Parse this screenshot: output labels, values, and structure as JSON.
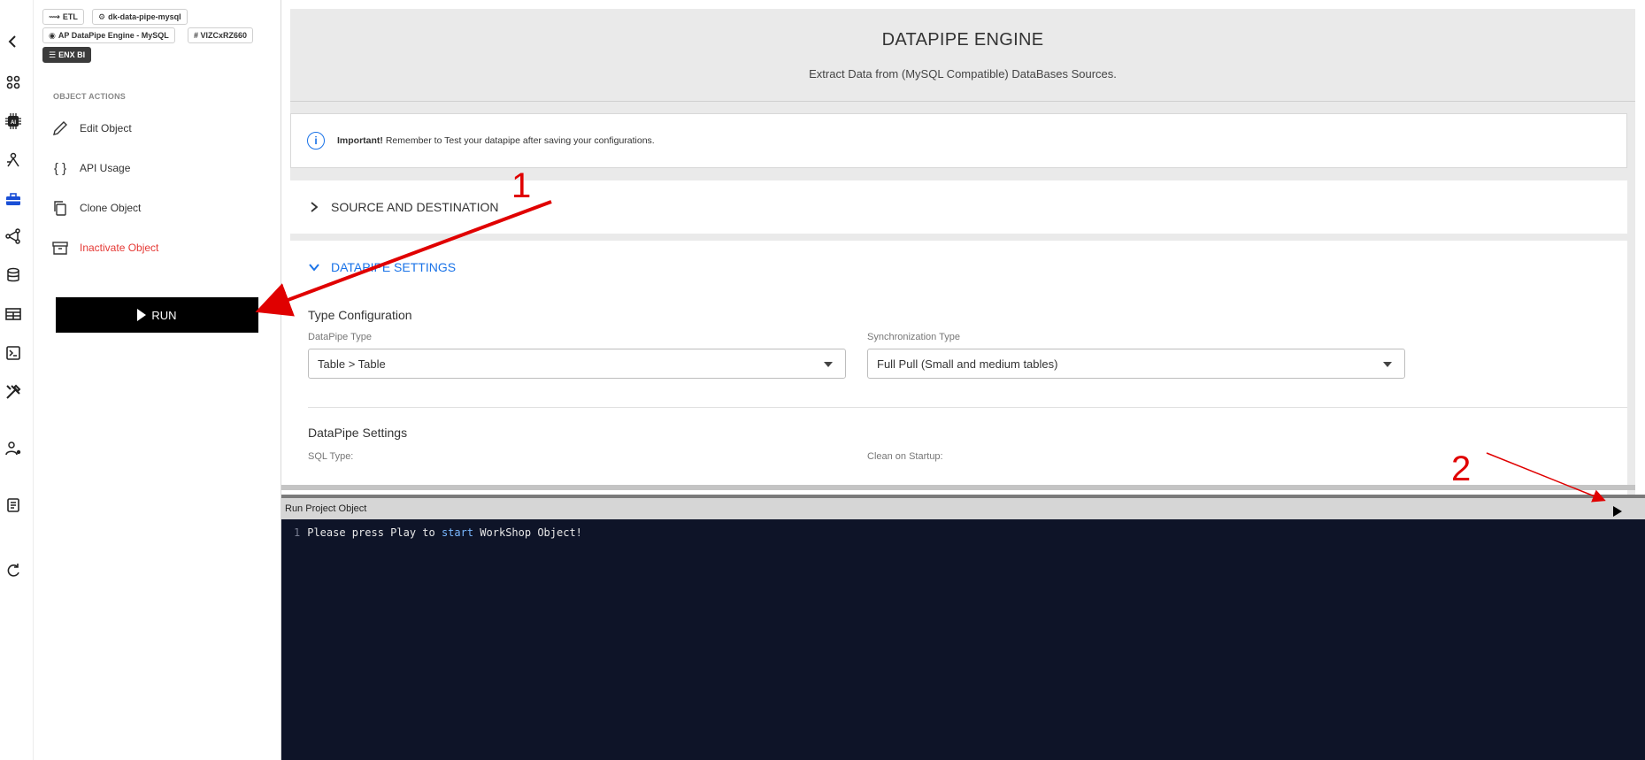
{
  "rail": {
    "icons": [
      "back-icon",
      "apps-icon",
      "ai-chip-icon",
      "integrations-icon",
      "toolbox-icon",
      "pipeline-icon",
      "database-icon",
      "table-icon",
      "terminal-icon",
      "tools-icon",
      "user-settings-icon",
      "document-icon",
      "refresh-icon"
    ],
    "active": "toolbox-icon"
  },
  "panel": {
    "tags": [
      "ETL",
      "dk-data-pipe-mysql",
      "AP DataPipe Engine - MySQL",
      "# VlZCxRZ660",
      "ENX BI"
    ],
    "section_label": "OBJECT ACTIONS",
    "actions": [
      {
        "label": "Edit Object",
        "icon": "pencil-icon"
      },
      {
        "label": "API Usage",
        "icon": "braces-icon"
      },
      {
        "label": "Clone Object",
        "icon": "copy-icon"
      },
      {
        "label": "Inactivate Object",
        "icon": "archive-icon"
      }
    ],
    "run_label": "RUN"
  },
  "main": {
    "title": "DATAPIPE ENGINE",
    "subtitle": "Extract Data from (MySQL Compatible) DataBases Sources.",
    "notice_bold": "Important!",
    "notice_text": " Remember to Test your datapipe after saving your configurations.",
    "accordion_source": "SOURCE AND DESTINATION",
    "accordion_settings": "DATAPIPE SETTINGS",
    "type_config": "Type Configuration",
    "datapipe_type_label": "DataPipe Type",
    "datapipe_type_value": "Table > Table",
    "sync_type_label": "Synchronization Type",
    "sync_type_value": "Full Pull (Small and medium tables)",
    "datapipe_settings": "DataPipe Settings",
    "sql_type_label": "SQL Type:",
    "clean_startup_label": "Clean on Startup:"
  },
  "console": {
    "title": "Run Project Object",
    "line_number": "1",
    "text_before": "Please press Play to ",
    "keyword": "start",
    "text_after": " WorkShop Object!"
  },
  "annotations": {
    "one": "1",
    "two": "2",
    "color": "#e00000"
  }
}
